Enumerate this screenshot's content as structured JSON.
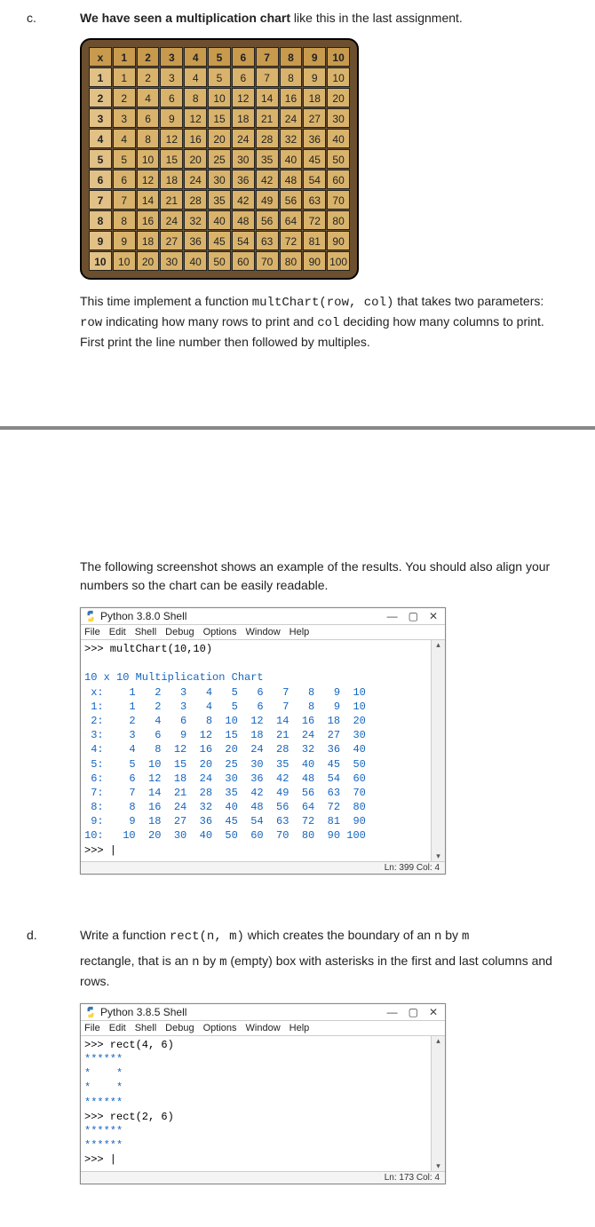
{
  "c": {
    "letter": "c.",
    "intro_bold": "We have seen a multiplication chart",
    "intro_rest": " like this in the last assignment.",
    "chart": {
      "corner": "x",
      "headers": [
        "1",
        "2",
        "3",
        "4",
        "5",
        "6",
        "7",
        "8",
        "9",
        "10"
      ],
      "rows": [
        {
          "label": "1",
          "cells": [
            "1",
            "2",
            "3",
            "4",
            "5",
            "6",
            "7",
            "8",
            "9",
            "10"
          ]
        },
        {
          "label": "2",
          "cells": [
            "2",
            "4",
            "6",
            "8",
            "10",
            "12",
            "14",
            "16",
            "18",
            "20"
          ]
        },
        {
          "label": "3",
          "cells": [
            "3",
            "6",
            "9",
            "12",
            "15",
            "18",
            "21",
            "24",
            "27",
            "30"
          ]
        },
        {
          "label": "4",
          "cells": [
            "4",
            "8",
            "12",
            "16",
            "20",
            "24",
            "28",
            "32",
            "36",
            "40"
          ]
        },
        {
          "label": "5",
          "cells": [
            "5",
            "10",
            "15",
            "20",
            "25",
            "30",
            "35",
            "40",
            "45",
            "50"
          ]
        },
        {
          "label": "6",
          "cells": [
            "6",
            "12",
            "18",
            "24",
            "30",
            "36",
            "42",
            "48",
            "54",
            "60"
          ]
        },
        {
          "label": "7",
          "cells": [
            "7",
            "14",
            "21",
            "28",
            "35",
            "42",
            "49",
            "56",
            "63",
            "70"
          ]
        },
        {
          "label": "8",
          "cells": [
            "8",
            "16",
            "24",
            "32",
            "40",
            "48",
            "56",
            "64",
            "72",
            "80"
          ]
        },
        {
          "label": "9",
          "cells": [
            "9",
            "18",
            "27",
            "36",
            "45",
            "54",
            "63",
            "72",
            "81",
            "90"
          ]
        },
        {
          "label": "10",
          "cells": [
            "10",
            "20",
            "30",
            "40",
            "50",
            "60",
            "70",
            "80",
            "90",
            "100"
          ]
        }
      ]
    },
    "desc_pre": "This time implement a function ",
    "desc_fn": "multChart(row, col)",
    "desc_mid": " that takes two parameters: ",
    "desc_row": "row",
    "desc_mid2": " indicating how many rows to print and ",
    "desc_col": "col",
    "desc_end": " deciding how many columns to print. First print the line number then followed by multiples.",
    "result_para": "The following screenshot shows an example of the results. You should also align your numbers so the chart can be easily readable.",
    "shell": {
      "title": "Python 3.8.0 Shell",
      "menu": [
        "File",
        "Edit",
        "Shell",
        "Debug",
        "Options",
        "Window",
        "Help"
      ],
      "status": "Ln: 399  Col: 4",
      "lines": [
        {
          "t": ">>> multChart(10,10)",
          "cls": "black"
        },
        {
          "t": "",
          "cls": "blue"
        },
        {
          "t": "10 x 10 Multiplication Chart",
          "cls": "blue"
        },
        {
          "t": " x:    1   2   3   4   5   6   7   8   9  10",
          "cls": "blue"
        },
        {
          "t": " 1:    1   2   3   4   5   6   7   8   9  10",
          "cls": "blue"
        },
        {
          "t": " 2:    2   4   6   8  10  12  14  16  18  20",
          "cls": "blue"
        },
        {
          "t": " 3:    3   6   9  12  15  18  21  24  27  30",
          "cls": "blue"
        },
        {
          "t": " 4:    4   8  12  16  20  24  28  32  36  40",
          "cls": "blue"
        },
        {
          "t": " 5:    5  10  15  20  25  30  35  40  45  50",
          "cls": "blue"
        },
        {
          "t": " 6:    6  12  18  24  30  36  42  48  54  60",
          "cls": "blue"
        },
        {
          "t": " 7:    7  14  21  28  35  42  49  56  63  70",
          "cls": "blue"
        },
        {
          "t": " 8:    8  16  24  32  40  48  56  64  72  80",
          "cls": "blue"
        },
        {
          "t": " 9:    9  18  27  36  45  54  63  72  81  90",
          "cls": "blue"
        },
        {
          "t": "10:   10  20  30  40  50  60  70  80  90 100",
          "cls": "blue"
        },
        {
          "t": ">>> |",
          "cls": "black"
        }
      ]
    }
  },
  "d": {
    "letter": "d.",
    "pre": "Write a function ",
    "fn": "rect(n, m)",
    "mid": " which creates the boundary of an ",
    "n": "n",
    "by": " by ",
    "m": "m",
    "tail": " rectangle, that is an ",
    "n2": "n",
    "by2": " by ",
    "m2": "m",
    "tail2": " (empty) box with asterisks in the first and last columns and rows.",
    "shell": {
      "title": "Python 3.8.5 Shell",
      "menu": [
        "File",
        "Edit",
        "Shell",
        "Debug",
        "Options",
        "Window",
        "Help"
      ],
      "status": "Ln: 173  Col: 4",
      "lines": [
        {
          "t": ">>> rect(4, 6)",
          "cls": "black"
        },
        {
          "t": "******",
          "cls": "blue"
        },
        {
          "t": "*    *",
          "cls": "blue"
        },
        {
          "t": "*    *",
          "cls": "blue"
        },
        {
          "t": "******",
          "cls": "blue"
        },
        {
          "t": ">>> rect(2, 6)",
          "cls": "black"
        },
        {
          "t": "******",
          "cls": "blue"
        },
        {
          "t": "******",
          "cls": "blue"
        },
        {
          "t": ">>> |",
          "cls": "black"
        }
      ]
    }
  }
}
